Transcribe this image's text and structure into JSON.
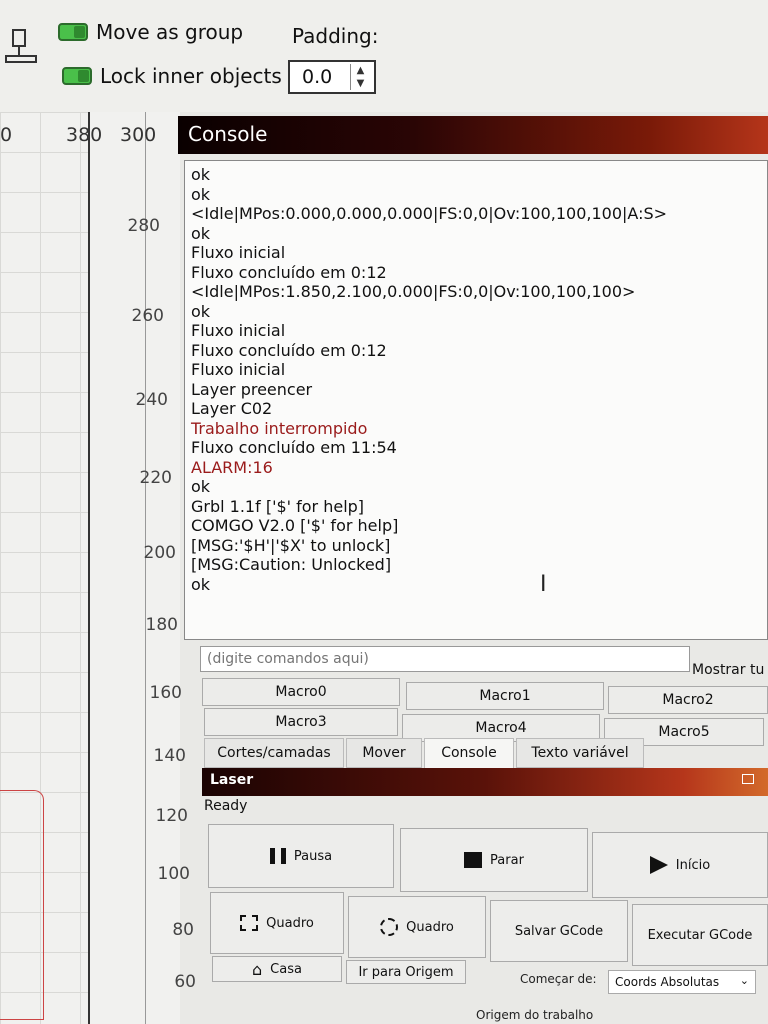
{
  "toolbar": {
    "move_as_group": "Move as group",
    "lock_inner": "Lock inner objects",
    "padding_label": "Padding:",
    "padding_value": "0.0"
  },
  "ruler": {
    "horizontal": [
      "0",
      "380",
      "300"
    ],
    "vertical": [
      "280",
      "260",
      "240",
      "220",
      "200",
      "180",
      "160",
      "140",
      "120",
      "100",
      "80",
      "60"
    ]
  },
  "console": {
    "title": "Console",
    "lines": [
      "ok",
      "ok",
      "<Idle|MPos:0.000,0.000,0.000|FS:0,0|Ov:100,100,100|A:S>",
      "ok",
      "Fluxo inicial",
      "Fluxo concluído em 0:12",
      "<Idle|MPos:1.850,2.100,0.000|FS:0,0|Ov:100,100,100>",
      "ok",
      "Fluxo inicial",
      "Fluxo concluído em 0:12",
      "Fluxo inicial",
      "Layer preencer",
      "Layer C02",
      "Trabalho interrompido",
      "Fluxo concluído em 11:54",
      "ALARM:16",
      "ok",
      "Grbl 1.1f ['$' for help]",
      "COMGO V2.0 ['$' for help]",
      "[MSG:'$H'|'$X' to unlock]",
      "[MSG:Caution: Unlocked]",
      "ok"
    ],
    "cmd_placeholder": "(digite comandos aqui)",
    "show_all": "Mostrar tu",
    "macros": [
      "Macro0",
      "Macro1",
      "Macro2",
      "Macro3",
      "Macro4",
      "Macro5"
    ]
  },
  "tabs": [
    "Cortes/camadas",
    "Mover",
    "Console",
    "Texto variável"
  ],
  "laser": {
    "title": "Laser",
    "status": "Ready",
    "pause": "Pausa",
    "stop": "Parar",
    "start": "Início",
    "frame1": "Quadro",
    "frame2": "Quadro",
    "save_gcode": "Salvar GCode",
    "run_gcode": "Executar GCode",
    "home": "Casa",
    "go_origin": "Ir para Origem",
    "start_from_label": "Começar de:",
    "start_from_value": "Coords Absolutas",
    "job_origin": "Origem do trabalho"
  }
}
